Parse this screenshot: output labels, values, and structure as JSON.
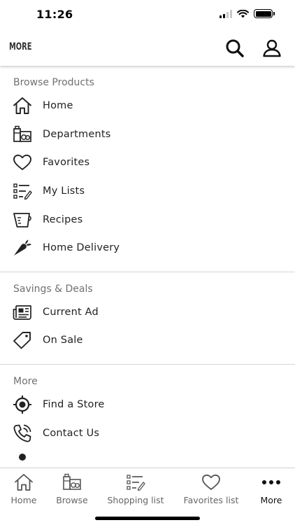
{
  "status_bar": {
    "time": "11:26"
  },
  "header": {
    "title": "MORE"
  },
  "sections": [
    {
      "title": "Browse Products",
      "items": [
        {
          "label": "Home",
          "icon": "home-icon"
        },
        {
          "label": "Departments",
          "icon": "grocery-icon"
        },
        {
          "label": "Favorites",
          "icon": "heart-icon"
        },
        {
          "label": "My Lists",
          "icon": "list-icon"
        },
        {
          "label": "Recipes",
          "icon": "measuring-cup-icon"
        },
        {
          "label": "Home Delivery",
          "icon": "carrot-icon"
        }
      ]
    },
    {
      "title": "Savings & Deals",
      "items": [
        {
          "label": "Current Ad",
          "icon": "newspaper-icon"
        },
        {
          "label": "On Sale",
          "icon": "tag-icon"
        }
      ]
    },
    {
      "title": "More",
      "items": [
        {
          "label": "Find a Store",
          "icon": "location-icon"
        },
        {
          "label": "Contact Us",
          "icon": "phone-icon"
        }
      ]
    }
  ],
  "tabs": [
    {
      "label": "Home",
      "icon": "home-icon"
    },
    {
      "label": "Browse",
      "icon": "grocery-icon"
    },
    {
      "label": "Shopping list",
      "icon": "list-icon"
    },
    {
      "label": "Favorites list",
      "icon": "heart-icon"
    },
    {
      "label": "More",
      "icon": "more-dots-icon",
      "active": true
    }
  ],
  "colors": {
    "text": "#222222",
    "section_title": "#707070",
    "divider": "#d6d6d6",
    "tab_label": "#666666"
  }
}
